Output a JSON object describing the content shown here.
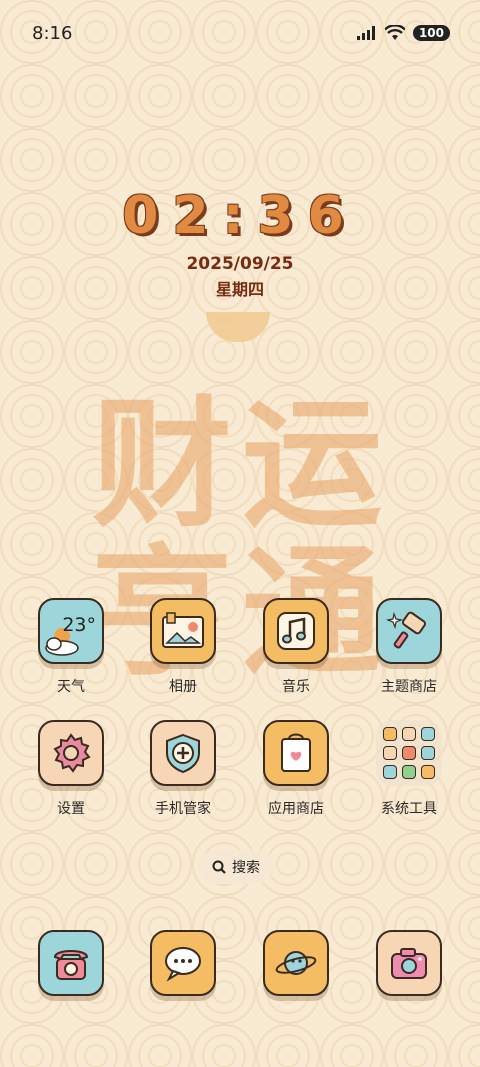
{
  "status_bar": {
    "time": "8:16",
    "battery": "100"
  },
  "clock": {
    "time": "02:36",
    "date": "2025/09/25",
    "weekday": "星期四"
  },
  "wallpaper_text": {
    "line1": "财运",
    "line2": "亨通"
  },
  "apps_row1": [
    {
      "label": "天气",
      "weather_temp": "23°",
      "icon": "weather-icon"
    },
    {
      "label": "相册",
      "icon": "gallery-icon"
    },
    {
      "label": "音乐",
      "icon": "music-icon"
    },
    {
      "label": "主题商店",
      "icon": "theme-store-icon"
    }
  ],
  "apps_row2": [
    {
      "label": "设置",
      "icon": "gear-icon"
    },
    {
      "label": "手机管家",
      "icon": "security-icon"
    },
    {
      "label": "应用商店",
      "icon": "app-store-icon"
    },
    {
      "label": "系统工具",
      "icon": "folder-icon"
    }
  ],
  "search": {
    "label": "搜索"
  },
  "dock": [
    {
      "icon": "phone-icon"
    },
    {
      "icon": "message-icon"
    },
    {
      "icon": "browser-icon"
    },
    {
      "icon": "camera-icon"
    }
  ]
}
